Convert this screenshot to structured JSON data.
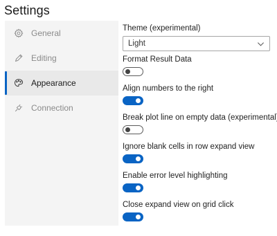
{
  "page": {
    "title": "Settings"
  },
  "sidebar": {
    "items": [
      {
        "label": "General",
        "icon": "gear-icon",
        "active": false
      },
      {
        "label": "Editing",
        "icon": "pencil-icon",
        "active": false
      },
      {
        "label": "Appearance",
        "icon": "palette-icon",
        "active": true
      },
      {
        "label": "Connection",
        "icon": "plug-icon",
        "active": false
      }
    ]
  },
  "settings": {
    "theme": {
      "label": "Theme (experimental)",
      "value": "Light"
    },
    "format_result": {
      "label": "Format Result Data",
      "on": false
    },
    "align_numbers": {
      "label": "Align numbers to the right",
      "on": true
    },
    "break_plot": {
      "label": "Break plot line on empty data (experimental)",
      "on": false
    },
    "ignore_blank": {
      "label": "Ignore blank cells in row expand view",
      "on": true
    },
    "error_highlight": {
      "label": "Enable error level highlighting",
      "on": true
    },
    "close_expand": {
      "label": "Close expand view on grid click",
      "on": true
    }
  },
  "colors": {
    "accent": "#0a64c4",
    "sidebar_bg": "#f4f4f4",
    "active_item_bg": "#e9e9e9"
  }
}
